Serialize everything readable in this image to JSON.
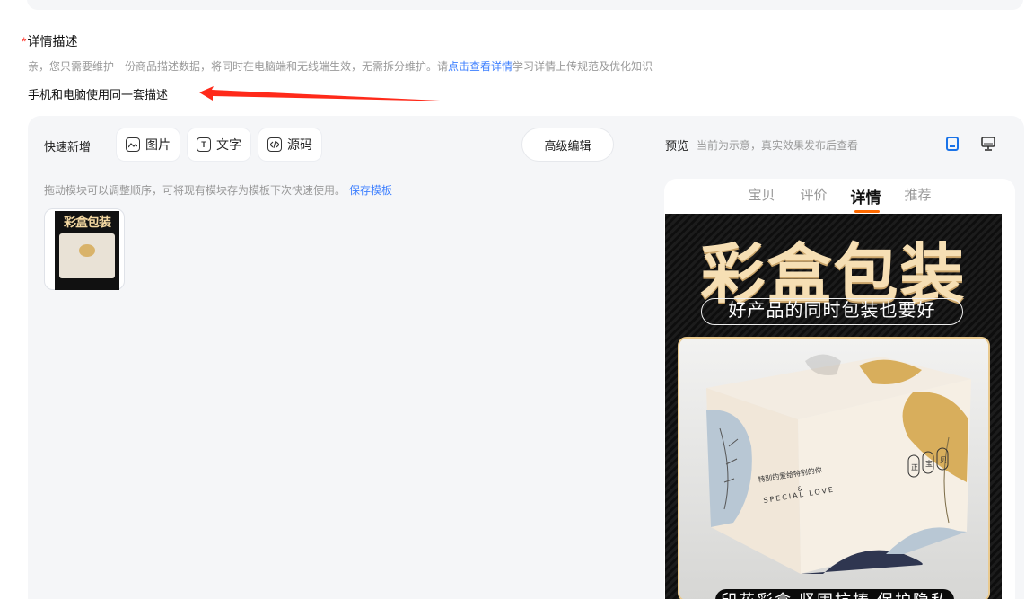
{
  "section": {
    "required_mark": "*",
    "title": "详情描述",
    "tip_prefix": "亲，您只需要维护一份商品描述数据，将同时在电脑端和无线端生效，无需拆分维护。请",
    "tip_link": "点击查看详情",
    "tip_suffix": "学习详情上传规范及优化知识",
    "subline": "手机和电脑使用同一套描述"
  },
  "toolbar": {
    "quick_add_label": "快速新增",
    "buttons": [
      {
        "label": "图片",
        "icon": "image-icon"
      },
      {
        "label": "文字",
        "icon": "text-icon"
      },
      {
        "label": "源码",
        "icon": "code-icon"
      }
    ],
    "advanced_label": "高级编辑"
  },
  "preview": {
    "label": "预览",
    "note": "当前为示意，真实效果发布后查看",
    "device_icons": [
      "mobile-icon",
      "desktop-icon"
    ],
    "active_device_color": "#1a73e8",
    "tabs": [
      "宝贝",
      "评价",
      "详情",
      "推荐"
    ],
    "active_tab": "详情"
  },
  "modules": {
    "drag_tip": "拖动模块可以调整顺序，可将现有模块存为模板下次快速使用。",
    "save_template": "保存模板",
    "thumb_title": "彩盒包装"
  },
  "banner": {
    "headline": "彩盒包装",
    "slogan": "好产品的同时包装也要好",
    "box_text_cn": "特别的爱给特别的你",
    "box_text_amp": "&",
    "box_text_en": "SPECIAL LOVE",
    "badges": [
      "正",
      "宝",
      "贝"
    ],
    "footer": "印花彩盒 坚固抗揍 保护隐私"
  },
  "colors": {
    "accent": "#3d7fff",
    "required": "#ff3b30",
    "tab_indicator": "#ff6a00",
    "annotation_arrow": "#ff2a1a",
    "gold": "#f6dfb4"
  }
}
